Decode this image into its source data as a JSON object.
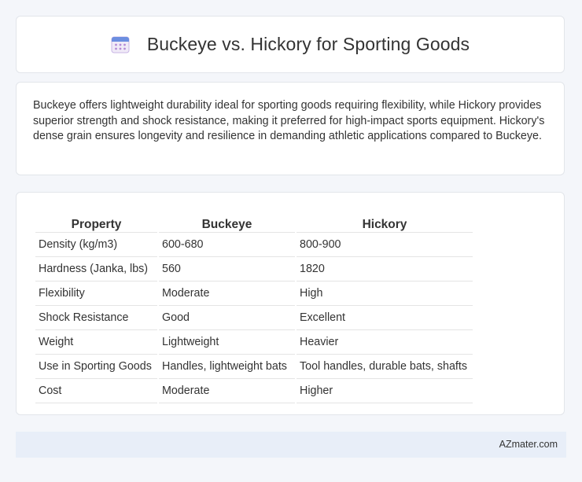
{
  "header": {
    "title": "Buckeye vs. Hickory for Sporting Goods",
    "icon": "calendar-icon",
    "icon_colors": {
      "top": "#6c8ee0",
      "body": "#f0eaf7",
      "dots": "#b48ad6"
    }
  },
  "summary": {
    "text": "Buckeye offers lightweight durability ideal for sporting goods requiring flexibility, while Hickory provides superior strength and shock resistance, making it preferred for high-impact sports equipment. Hickory's dense grain ensures longevity and resilience in demanding athletic applications compared to Buckeye."
  },
  "table": {
    "headers": [
      "Property",
      "Buckeye",
      "Hickory"
    ],
    "rows": [
      [
        "Density (kg/m3)",
        "600-680",
        "800-900"
      ],
      [
        "Hardness (Janka, lbs)",
        "560",
        "1820"
      ],
      [
        "Flexibility",
        "Moderate",
        "High"
      ],
      [
        "Shock Resistance",
        "Good",
        "Excellent"
      ],
      [
        "Weight",
        "Lightweight",
        "Heavier"
      ],
      [
        "Use in Sporting Goods",
        "Handles, lightweight bats",
        "Tool handles, durable bats, shafts"
      ],
      [
        "Cost",
        "Moderate",
        "Higher"
      ]
    ]
  },
  "footer": {
    "brand": "AZmater.com"
  }
}
